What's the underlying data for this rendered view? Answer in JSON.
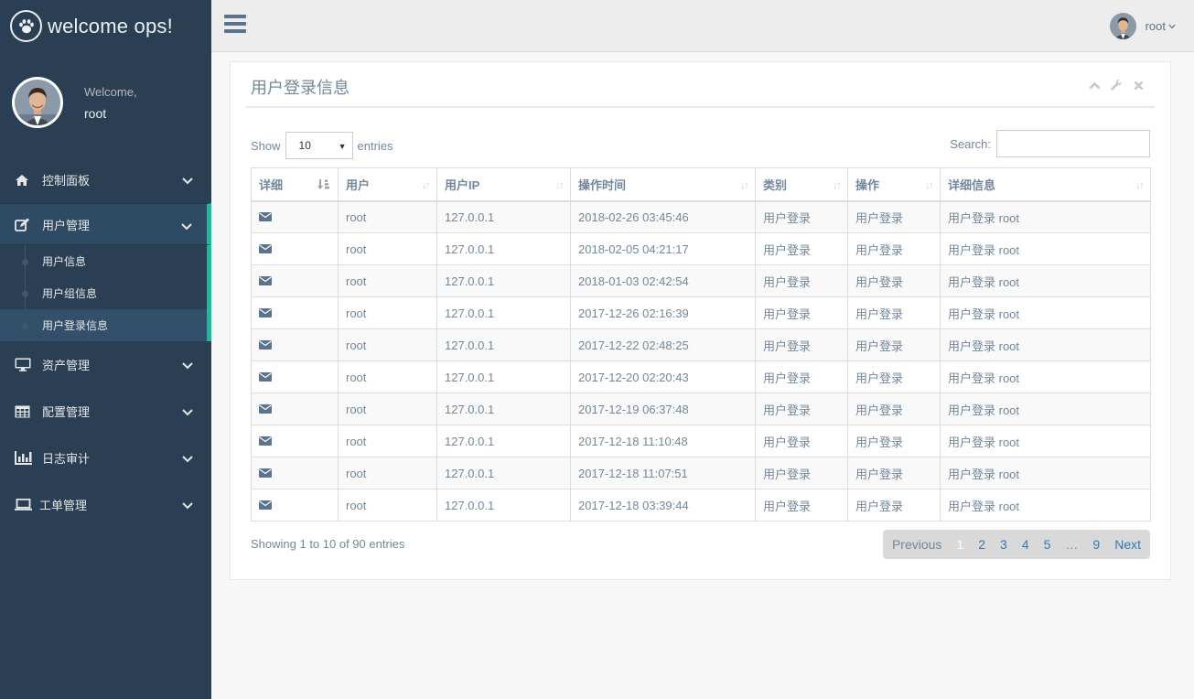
{
  "brand": {
    "title": "welcome ops!",
    "logo_icon": "paw-icon"
  },
  "profile": {
    "welcome": "Welcome,",
    "name": "root"
  },
  "sidebar": {
    "items": [
      {
        "label": "控制面板",
        "icon": "home-icon"
      },
      {
        "label": "用户管理",
        "icon": "edit-icon"
      },
      {
        "label": "资产管理",
        "icon": "desktop-icon"
      },
      {
        "label": "配置管理",
        "icon": "table-icon"
      },
      {
        "label": "日志审计",
        "icon": "bar-chart-icon"
      },
      {
        "label": "工单管理",
        "icon": "laptop-icon"
      }
    ],
    "submenu": [
      {
        "label": "用户信息"
      },
      {
        "label": "用户组信息"
      },
      {
        "label": "用户登录信息"
      }
    ]
  },
  "topnav": {
    "user": "root"
  },
  "panel": {
    "title": "用户登录信息",
    "length_label_before": "Show",
    "length_value": "10",
    "length_label_after": "entries",
    "search_label": "Search:",
    "search_value": ""
  },
  "table": {
    "headers": [
      "详细",
      "用户",
      "用户IP",
      "操作时间",
      "类别",
      "操作",
      "详细信息"
    ],
    "rows": [
      [
        "root",
        "127.0.0.1",
        "2018-02-26 03:45:46",
        "用户登录",
        "用户登录",
        "用户登录 root"
      ],
      [
        "root",
        "127.0.0.1",
        "2018-02-05 04:21:17",
        "用户登录",
        "用户登录",
        "用户登录 root"
      ],
      [
        "root",
        "127.0.0.1",
        "2018-01-03 02:42:54",
        "用户登录",
        "用户登录",
        "用户登录 root"
      ],
      [
        "root",
        "127.0.0.1",
        "2017-12-26 02:16:39",
        "用户登录",
        "用户登录",
        "用户登录 root"
      ],
      [
        "root",
        "127.0.0.1",
        "2017-12-22 02:48:25",
        "用户登录",
        "用户登录",
        "用户登录 root"
      ],
      [
        "root",
        "127.0.0.1",
        "2017-12-20 02:20:43",
        "用户登录",
        "用户登录",
        "用户登录 root"
      ],
      [
        "root",
        "127.0.0.1",
        "2017-12-19 06:37:48",
        "用户登录",
        "用户登录",
        "用户登录 root"
      ],
      [
        "root",
        "127.0.0.1",
        "2017-12-18 11:10:48",
        "用户登录",
        "用户登录",
        "用户登录 root"
      ],
      [
        "root",
        "127.0.0.1",
        "2017-12-18 11:07:51",
        "用户登录",
        "用户登录",
        "用户登录 root"
      ],
      [
        "root",
        "127.0.0.1",
        "2017-12-18 03:39:44",
        "用户登录",
        "用户登录",
        "用户登录 root"
      ]
    ]
  },
  "footer": {
    "info": "Showing 1 to 10 of 90 entries",
    "previous": "Previous",
    "pages": [
      "1",
      "2",
      "3",
      "4",
      "5",
      "…",
      "9"
    ],
    "next": "Next"
  },
  "colors": {
    "sidebar": "#2a3f54",
    "accent": "#1abb9c",
    "link": "#337ab7"
  }
}
